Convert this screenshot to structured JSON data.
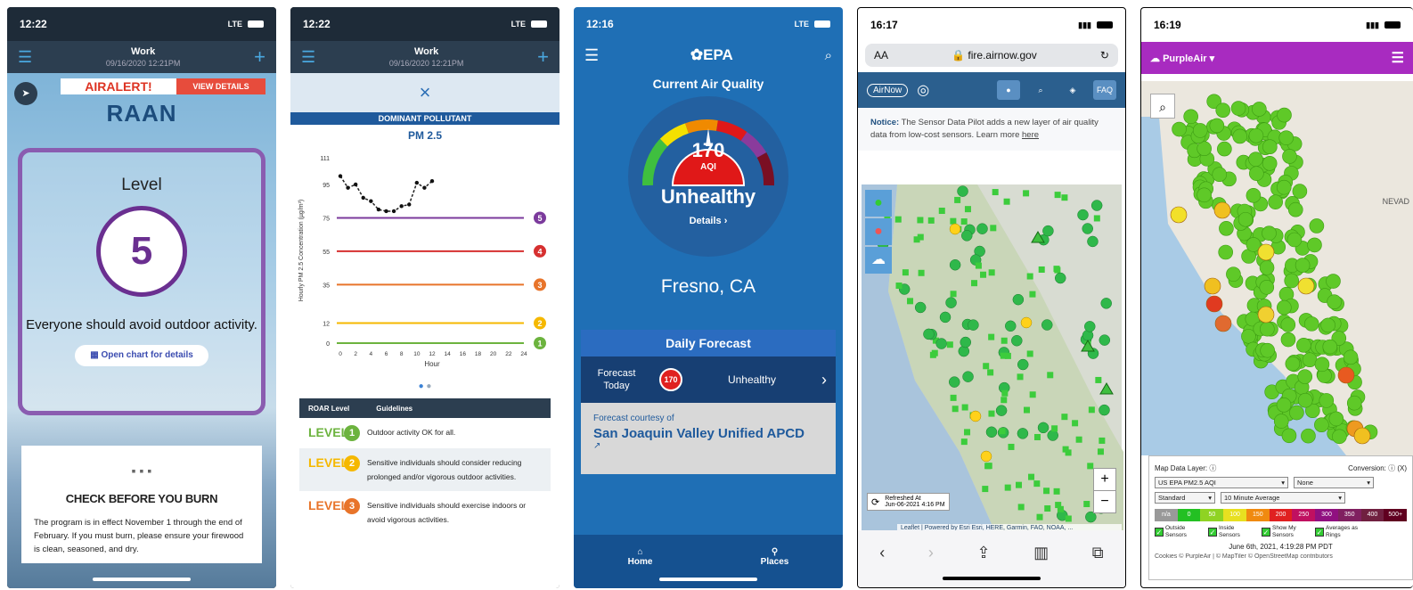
{
  "phone1": {
    "status": {
      "time": "12:22",
      "net": "LTE"
    },
    "header": {
      "title": "Work",
      "subtitle": "09/16/2020 12:21PM"
    },
    "alert": {
      "label": "AIRALERT!",
      "view": "VIEW DETAILS"
    },
    "logo": "RAAN",
    "level": {
      "title": "Level",
      "value": "5",
      "message": "Everyone should avoid outdoor activity.",
      "button": "Open chart for details"
    },
    "burn": {
      "title": "CHECK BEFORE YOU BURN",
      "text": "The program is in effect November 1 through the end of February. If you must burn, please ensure your firewood is clean, seasoned, and dry."
    }
  },
  "phone2": {
    "status": {
      "time": "12:22",
      "net": "LTE"
    },
    "header": {
      "title": "Work",
      "subtitle": "09/16/2020 12:21PM"
    },
    "close": "×",
    "dominant": "DOMINANT POLLUTANT",
    "pollutant": "PM 2.5",
    "table_head": {
      "c1": "ROAR Level",
      "c2": "Guidelines"
    },
    "levels": [
      {
        "label": "LEVEL",
        "num": "1",
        "color": "#6cb33e",
        "text": "Outdoor activity OK for all."
      },
      {
        "label": "LEVEL",
        "num": "2",
        "color": "#f5b800",
        "text": "Sensitive individuals should consider reducing prolonged and/or vigorous outdoor activities."
      },
      {
        "label": "LEVEL",
        "num": "3",
        "color": "#e8742a",
        "text": "Sensitive individuals should exercise indoors or avoid vigorous activities."
      }
    ],
    "chart_data": {
      "type": "line",
      "ylabel": "Hourly PM 2.5 Concentration (µg/m³)",
      "xlabel": "Hour",
      "x": [
        0,
        1,
        2,
        3,
        4,
        5,
        6,
        7,
        8,
        9,
        10,
        11,
        12
      ],
      "values": [
        100,
        93,
        95,
        87,
        85,
        80,
        79,
        79,
        82,
        83,
        96,
        93,
        97
      ],
      "xticks": [
        "0",
        "2",
        "4",
        "6",
        "8",
        "10",
        "12",
        "14",
        "16",
        "18",
        "20",
        "22",
        "24"
      ],
      "yticks": [
        "0",
        "12",
        "35",
        "55",
        "75",
        "95",
        "111"
      ],
      "thresholds": [
        {
          "value": 12,
          "color": "#f5b800",
          "level": "2"
        },
        {
          "value": 35,
          "color": "#e8742a",
          "level": "3"
        },
        {
          "value": 55,
          "color": "#d63030",
          "level": "4"
        },
        {
          "value": 75,
          "color": "#7b3a9c",
          "level": "5"
        }
      ],
      "base": {
        "value": 0,
        "color": "#6cb33e",
        "level": "1"
      },
      "ylim": [
        0,
        111
      ],
      "xlim": [
        0,
        24
      ]
    }
  },
  "phone3": {
    "status": {
      "time": "12:16",
      "net": "LTE"
    },
    "logo": "EPA",
    "title": "Current Air Quality",
    "aqi": "170",
    "aqi_label": "AQI",
    "category": "Unhealthy",
    "details": "Details",
    "city": "Fresno, CA",
    "forecast": {
      "title": "Daily Forecast",
      "day": "Forecast Today",
      "aqi": "170",
      "category": "Unhealthy"
    },
    "courtesy": {
      "label": "Forecast courtesy of",
      "org": "San Joaquin Valley Unified APCD"
    },
    "nav": {
      "home": "Home",
      "places": "Places"
    }
  },
  "phone4": {
    "status": {
      "time": "16:17"
    },
    "url": "fire.airnow.gov",
    "aa": "AA",
    "faq": "FAQ",
    "notice": {
      "bold": "Notice:",
      "text": "The Sensor Data Pilot adds a new layer of air quality data from low-cost sensors. Learn more",
      "link": "here"
    },
    "refreshed": {
      "label": "Refreshed At",
      "time": "Jun-06-2021 4:16 PM"
    },
    "attribution": "Leaflet | Powered by Esri  Esri, HERE, Garmin, FAO, NOAA, ..."
  },
  "phone5": {
    "status": {
      "time": "16:19"
    },
    "brand": "PurpleAir",
    "map_labels": {
      "nevada": "NEVAD"
    },
    "legend": {
      "layer_label": "Map Data Layer:",
      "layer_value": "US EPA PM2.5 AQI",
      "conversion_label": "Conversion:",
      "conversion_value": "None",
      "type_value": "Standard",
      "avg_value": "10 Minute Average",
      "scale": [
        "n/a",
        "0",
        "50",
        "100",
        "150",
        "200",
        "250",
        "300",
        "350",
        "400",
        "500+"
      ],
      "checks": [
        "Outside Sensors",
        "Inside Sensors",
        "Show My Sensors",
        "Averages as Rings"
      ],
      "timestamp": "June 6th, 2021, 4:19:28 PM PDT",
      "footer": "Cookies © PurpleAir | © MapTiler © OpenStreetMap contributors"
    }
  }
}
